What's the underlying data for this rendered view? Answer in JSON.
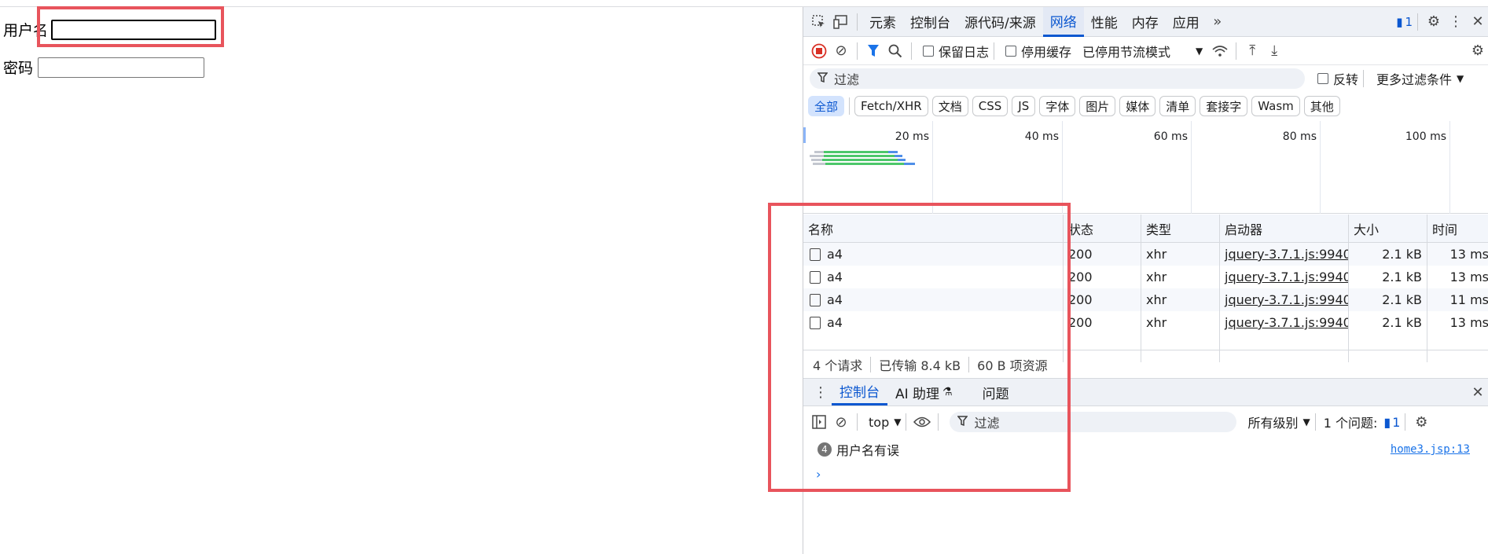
{
  "page": {
    "username_label": "用户名",
    "username_value": "",
    "password_label": "密码",
    "password_value": ""
  },
  "devtools": {
    "tabs": [
      "元素",
      "控制台",
      "源代码/来源",
      "网络",
      "性能",
      "内存",
      "应用"
    ],
    "active_tab": "网络",
    "issues_count": "1",
    "toolbar": {
      "preserve_log": "保留日志",
      "disable_cache": "停用缓存",
      "throttle": "已停用节流模式"
    },
    "filter": {
      "placeholder": "过滤",
      "invert": "反转",
      "more_filters": "更多过滤条件"
    },
    "type_filters": [
      "全部",
      "Fetch/XHR",
      "文档",
      "CSS",
      "JS",
      "字体",
      "图片",
      "媒体",
      "清单",
      "套接字",
      "Wasm",
      "其他"
    ],
    "timeline_ticks": [
      "20 ms",
      "40 ms",
      "60 ms",
      "80 ms",
      "100 ms"
    ],
    "table": {
      "headers": {
        "name": "名称",
        "status": "状态",
        "type": "类型",
        "initiator": "启动器",
        "size": "大小",
        "time": "时间"
      },
      "rows": [
        {
          "name": "a4",
          "status": "200",
          "type": "xhr",
          "initiator": "jquery-3.7.1.js:9940",
          "size": "2.1 kB",
          "time": "13 ms"
        },
        {
          "name": "a4",
          "status": "200",
          "type": "xhr",
          "initiator": "jquery-3.7.1.js:9940",
          "size": "2.1 kB",
          "time": "13 ms"
        },
        {
          "name": "a4",
          "status": "200",
          "type": "xhr",
          "initiator": "jquery-3.7.1.js:9940",
          "size": "2.1 kB",
          "time": "11 ms"
        },
        {
          "name": "a4",
          "status": "200",
          "type": "xhr",
          "initiator": "jquery-3.7.1.js:9940",
          "size": "2.1 kB",
          "time": "13 ms"
        }
      ]
    },
    "summary": {
      "requests": "4 个请求",
      "transferred": "已传输 8.4 kB",
      "resources": "60 B 项资源"
    },
    "drawer": {
      "tabs": [
        "控制台",
        "AI 助理",
        "问题"
      ],
      "active_tab": "控制台",
      "context": "top",
      "filter_placeholder": "过滤",
      "levels": "所有级别",
      "issues_label": "1 个问题:",
      "issues_count": "1",
      "message": {
        "repeat_count": "4",
        "text": "用户名有误",
        "source": "home3.jsp:13"
      },
      "prompt": "›"
    }
  }
}
